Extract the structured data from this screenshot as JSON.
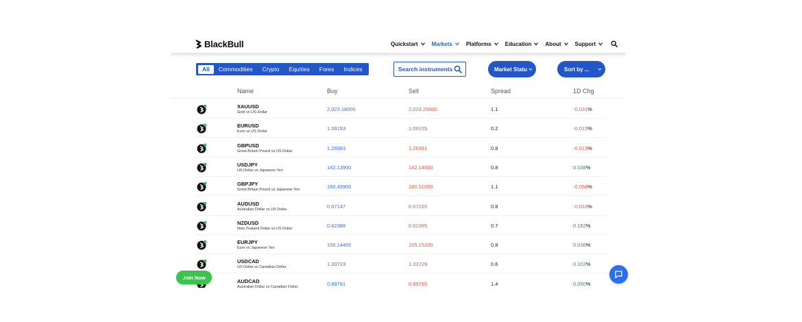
{
  "brand": {
    "name": "BlackBull"
  },
  "nav": {
    "items": [
      {
        "label": "Quickstart",
        "active": false
      },
      {
        "label": "Markets",
        "active": true
      },
      {
        "label": "Platforms",
        "active": false
      },
      {
        "label": "Education",
        "active": false
      },
      {
        "label": "About",
        "active": false
      },
      {
        "label": "Support",
        "active": false
      }
    ]
  },
  "filters": [
    "All",
    "Commodities",
    "Crypto",
    "Equities",
    "Forex",
    "Indices"
  ],
  "search": {
    "label": "Search instruments"
  },
  "dropdowns": {
    "market_status": "Market Statu",
    "sort_by": "Sort by ..."
  },
  "table": {
    "headers": {
      "name": "Name",
      "buy": "Buy",
      "sell": "Sell",
      "spread": "Spread",
      "change": "1D Chg"
    },
    "rows": [
      {
        "symbol": "XAUUSD",
        "desc": "Gold vs US-Dollar",
        "buy": "2,023.18000",
        "sell": "2,023.29000",
        "spread": "1.1",
        "change": "-0.031",
        "pct": "%",
        "dir": "neg"
      },
      {
        "symbol": "EURUSD",
        "desc": "Euro vs US Dollar",
        "buy": "1.09153",
        "sell": "1.09155",
        "spread": "0.2",
        "change": "-0.015",
        "pct": "%",
        "dir": "neg"
      },
      {
        "symbol": "GBPUSD",
        "desc": "Great Britain Pound vs US Dollar",
        "buy": "1.26983",
        "sell": "1.26991",
        "spread": "0.8",
        "change": "-0.013",
        "pct": "%",
        "dir": "neg"
      },
      {
        "symbol": "USDJPY",
        "desc": "US Dollar vs Japanese Yen",
        "buy": "142.13900",
        "sell": "142.14600",
        "spread": "0.8",
        "change": "0.038",
        "pct": "%",
        "dir": "pos"
      },
      {
        "symbol": "GBPJPY",
        "desc": "Great Britain Pound vs Japanese Yen",
        "buy": "180.49900",
        "sell": "180.51000",
        "spread": "1.1",
        "change": "-0.058",
        "pct": "%",
        "dir": "neg"
      },
      {
        "symbol": "AUDUSD",
        "desc": "Australian Dollar vs US Dollar",
        "buy": "0.67147",
        "sell": "0.67155",
        "spread": "0.8",
        "change": "-0.010",
        "pct": "%",
        "dir": "neg"
      },
      {
        "symbol": "NZDUSD",
        "desc": "New Zealand Dollar vs US Dollar",
        "buy": "0.62388",
        "sell": "0.62395",
        "spread": "0.7",
        "change": "0.182",
        "pct": "%",
        "dir": "pos"
      },
      {
        "symbol": "EURJPY",
        "desc": "Euro vs Japanese Yen",
        "buy": "155.14400",
        "sell": "155.15200",
        "spread": "0.8",
        "change": "0.036",
        "pct": "%",
        "dir": "pos"
      },
      {
        "symbol": "USDCAD",
        "desc": "US Dollar vs Canadian Dollar",
        "buy": "1.33723",
        "sell": "1.33729",
        "spread": "0.6",
        "change": "0.102",
        "pct": "%",
        "dir": "pos"
      },
      {
        "symbol": "AUDCAD",
        "desc": "Australian Dollar vs Canadian Dollar",
        "buy": "0.89781",
        "sell": "0.89795",
        "spread": "1.4",
        "change": "0.050",
        "pct": "%",
        "dir": "pos"
      }
    ]
  },
  "cta": {
    "join": "Join Now"
  },
  "colors": {
    "brand_blue": "#2356c6",
    "buy_blue": "#3e6fd8",
    "sell_red": "#e0553d",
    "positive_green": "#2e9b3e",
    "join_green": "#3cc34b",
    "chat_blue": "#2b6ff0"
  },
  "icons": {
    "logo": "bull-logo-icon",
    "search": "search-icon",
    "chat": "chat-icon",
    "chevron": "chevron-down-icon",
    "instrument": "bull-avatar-icon"
  }
}
